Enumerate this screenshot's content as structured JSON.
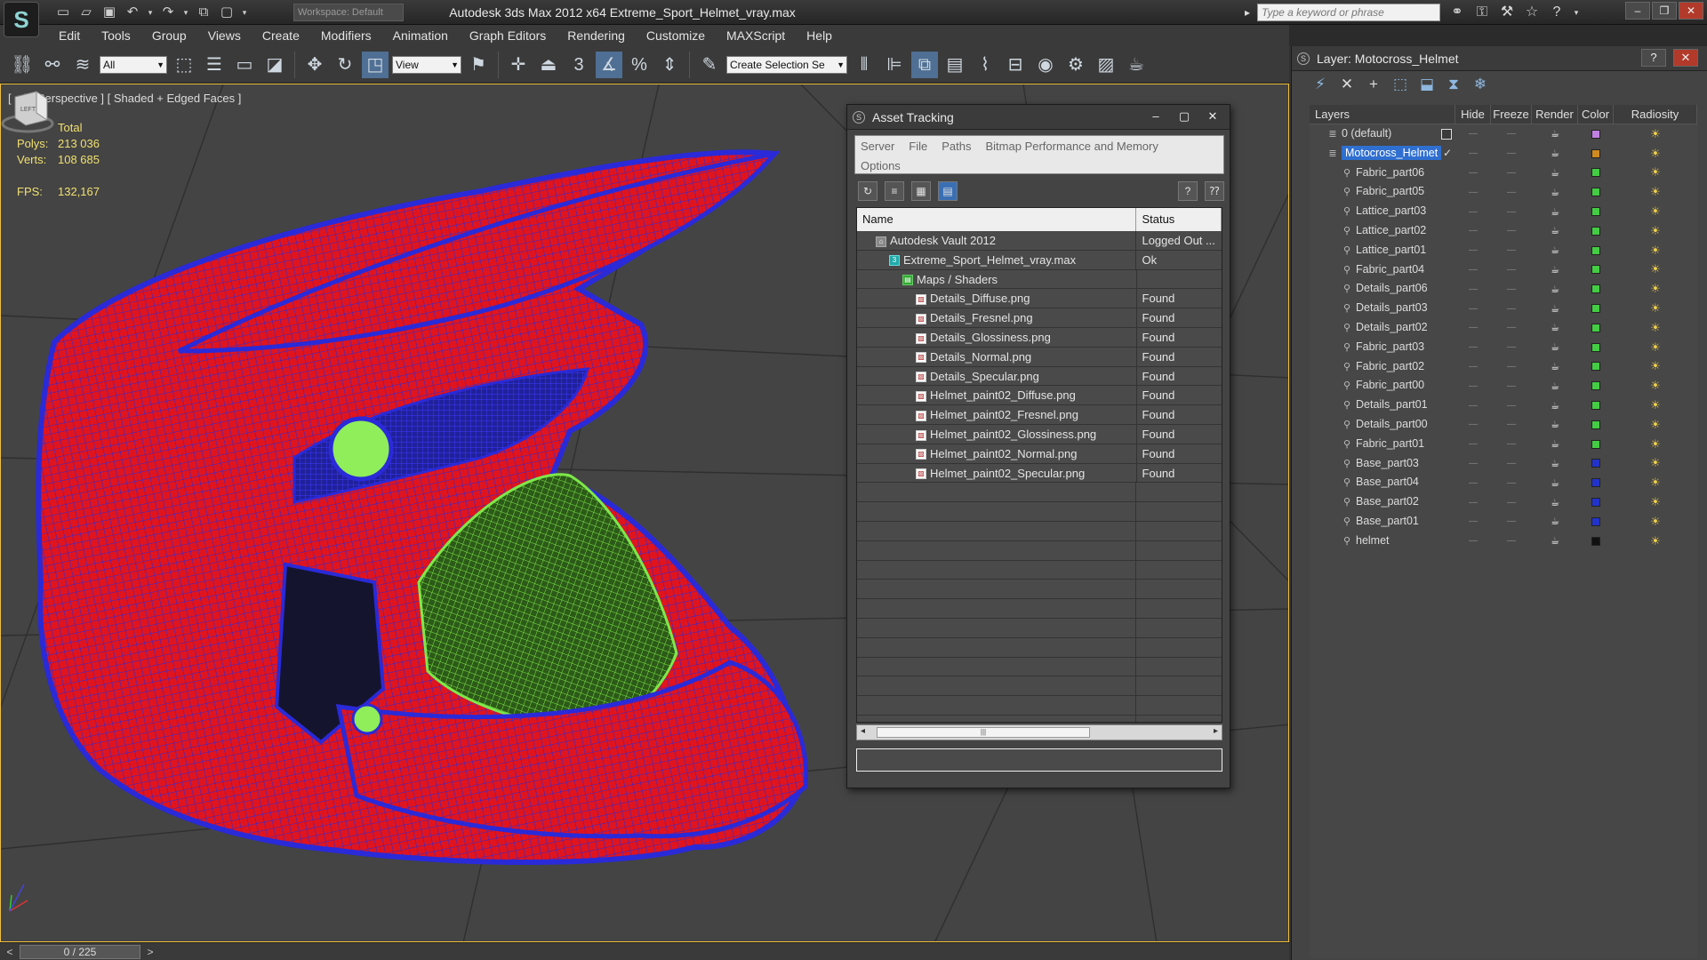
{
  "app": {
    "title": "Autodesk 3ds Max  2012 x64      Extreme_Sport_Helmet_vray.max",
    "logo": "S",
    "workspace_placeholder": "Workspace: Default",
    "search_placeholder": "Type a keyword or phrase"
  },
  "menu": [
    "Edit",
    "Tools",
    "Group",
    "Views",
    "Create",
    "Modifiers",
    "Animation",
    "Graph Editors",
    "Rendering",
    "Customize",
    "MAXScript",
    "Help"
  ],
  "toolbar": {
    "selection_filter": "All",
    "ref_coord": "View",
    "named_selection_placeholder": "Create Selection Se",
    "snap_label": "3",
    "percent_label": "%"
  },
  "viewport": {
    "label": "[ + ] [ Perspective ] [ Shaded + Edged Faces ]",
    "stats_header": "Total",
    "polys_label": "Polys:",
    "polys_value": "213 036",
    "verts_label": "Verts:",
    "verts_value": "108 685",
    "fps_label": "FPS:",
    "fps_value": "132,167",
    "viewcube_label": "LEFT"
  },
  "timeslider": {
    "value": "0 / 225",
    "prev": "<",
    "next": ">"
  },
  "asset_tracking": {
    "title": "Asset Tracking",
    "menu_row1": [
      "Server",
      "File",
      "Paths",
      "Bitmap Performance and Memory"
    ],
    "menu_row2": [
      "Options"
    ],
    "columns": {
      "name": "Name",
      "status": "Status"
    },
    "rows": [
      {
        "name": "Autodesk Vault 2012",
        "status": "Logged Out ...",
        "indent": 1,
        "icon": "vault"
      },
      {
        "name": "Extreme_Sport_Helmet_vray.max",
        "status": "Ok",
        "indent": 2,
        "icon": "max"
      },
      {
        "name": "Maps / Shaders",
        "status": "",
        "indent": 3,
        "icon": "folder"
      },
      {
        "name": "Details_Diffuse.png",
        "status": "Found",
        "indent": 4,
        "icon": "file"
      },
      {
        "name": "Details_Fresnel.png",
        "status": "Found",
        "indent": 4,
        "icon": "file"
      },
      {
        "name": "Details_Glossiness.png",
        "status": "Found",
        "indent": 4,
        "icon": "file"
      },
      {
        "name": "Details_Normal.png",
        "status": "Found",
        "indent": 4,
        "icon": "file"
      },
      {
        "name": "Details_Specular.png",
        "status": "Found",
        "indent": 4,
        "icon": "file"
      },
      {
        "name": "Helmet_paint02_Diffuse.png",
        "status": "Found",
        "indent": 4,
        "icon": "file"
      },
      {
        "name": "Helmet_paint02_Fresnel.png",
        "status": "Found",
        "indent": 4,
        "icon": "file"
      },
      {
        "name": "Helmet_paint02_Glossiness.png",
        "status": "Found",
        "indent": 4,
        "icon": "file"
      },
      {
        "name": "Helmet_paint02_Normal.png",
        "status": "Found",
        "indent": 4,
        "icon": "file"
      },
      {
        "name": "Helmet_paint02_Specular.png",
        "status": "Found",
        "indent": 4,
        "icon": "file"
      }
    ],
    "empty_rows": 13
  },
  "layers": {
    "title": "Layer: Motocross_Helmet",
    "columns": {
      "name": "Layers",
      "hide": "Hide",
      "freeze": "Freeze",
      "render": "Render",
      "color": "Color",
      "radiosity": "Radiosity"
    },
    "rows": [
      {
        "name": "0 (default)",
        "color": "#c080e0",
        "level": 0,
        "checkbox": true
      },
      {
        "name": "Motocross_Helmet",
        "color": "#d08a20",
        "level": 0,
        "selected": true,
        "active": true
      },
      {
        "name": "Fabric_part06",
        "color": "#44cc44",
        "level": 1
      },
      {
        "name": "Fabric_part05",
        "color": "#44cc44",
        "level": 1
      },
      {
        "name": "Lattice_part03",
        "color": "#44cc44",
        "level": 1
      },
      {
        "name": "Lattice_part02",
        "color": "#44cc44",
        "level": 1
      },
      {
        "name": "Lattice_part01",
        "color": "#44cc44",
        "level": 1
      },
      {
        "name": "Fabric_part04",
        "color": "#44cc44",
        "level": 1
      },
      {
        "name": "Details_part06",
        "color": "#44cc44",
        "level": 1
      },
      {
        "name": "Details_part03",
        "color": "#44cc44",
        "level": 1
      },
      {
        "name": "Details_part02",
        "color": "#44cc44",
        "level": 1
      },
      {
        "name": "Fabric_part03",
        "color": "#44cc44",
        "level": 1
      },
      {
        "name": "Fabric_part02",
        "color": "#44cc44",
        "level": 1
      },
      {
        "name": "Fabric_part00",
        "color": "#44cc44",
        "level": 1
      },
      {
        "name": "Details_part01",
        "color": "#44cc44",
        "level": 1
      },
      {
        "name": "Details_part00",
        "color": "#44cc44",
        "level": 1
      },
      {
        "name": "Fabric_part01",
        "color": "#44cc44",
        "level": 1
      },
      {
        "name": "Base_part03",
        "color": "#2233cc",
        "level": 1
      },
      {
        "name": "Base_part04",
        "color": "#2233cc",
        "level": 1
      },
      {
        "name": "Base_part02",
        "color": "#2233cc",
        "level": 1
      },
      {
        "name": "Base_part01",
        "color": "#2233cc",
        "level": 1
      },
      {
        "name": "helmet",
        "color": "#111111",
        "level": 1
      }
    ]
  },
  "colors": {
    "helmet_shell": "#e0141e",
    "helmet_wire": "#2a2ad8",
    "helmet_liner": "#7ee84a",
    "selection_blue": "#2f6fd0"
  }
}
